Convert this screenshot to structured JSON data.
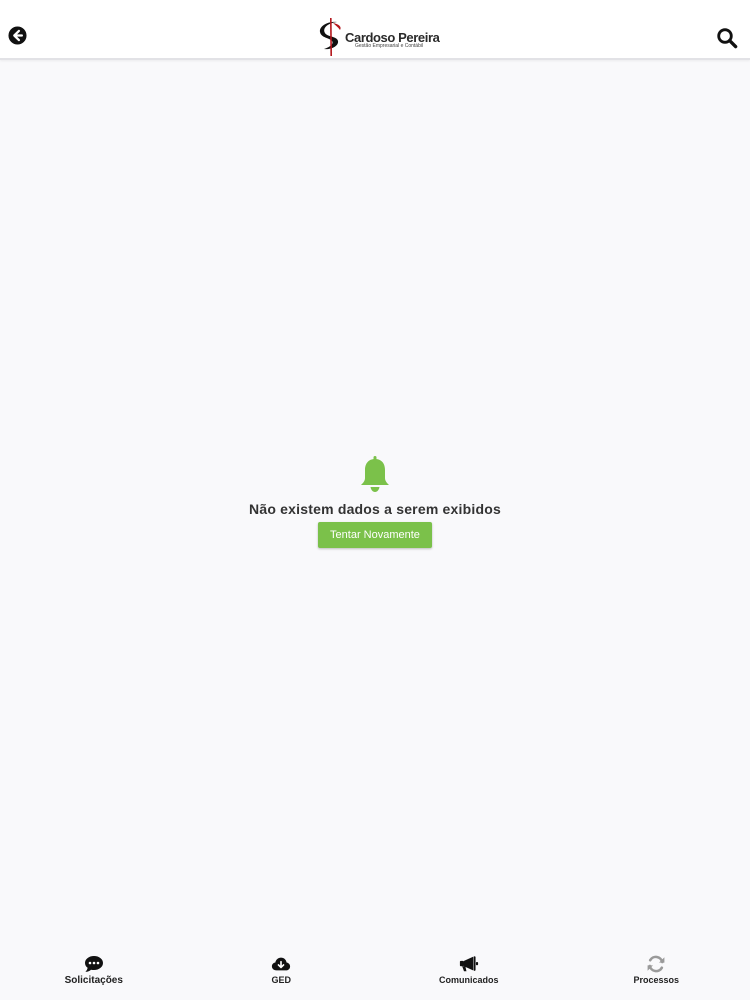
{
  "header": {
    "back_icon": "arrow-left-circle-icon",
    "search_icon": "search-icon",
    "logo": {
      "name": "Cardoso Pereira",
      "tagline": "Gestão Empresarial e Contábil"
    }
  },
  "empty_state": {
    "icon": "bell-icon",
    "message": "Não existem dados a serem exibidos",
    "retry_label": "Tentar Novamente"
  },
  "bottom_nav": {
    "items": [
      {
        "label": "Solicitações",
        "icon": "chat-bubble-icon"
      },
      {
        "label": "GED",
        "icon": "cloud-download-icon"
      },
      {
        "label": "Comunicados",
        "icon": "megaphone-icon"
      },
      {
        "label": "Processos",
        "icon": "refresh-icon"
      }
    ]
  },
  "colors": {
    "accent_green": "#7bc14a",
    "logo_red": "#b3151b",
    "text_dark": "#222222",
    "inactive_icon": "#9a9a9a"
  }
}
